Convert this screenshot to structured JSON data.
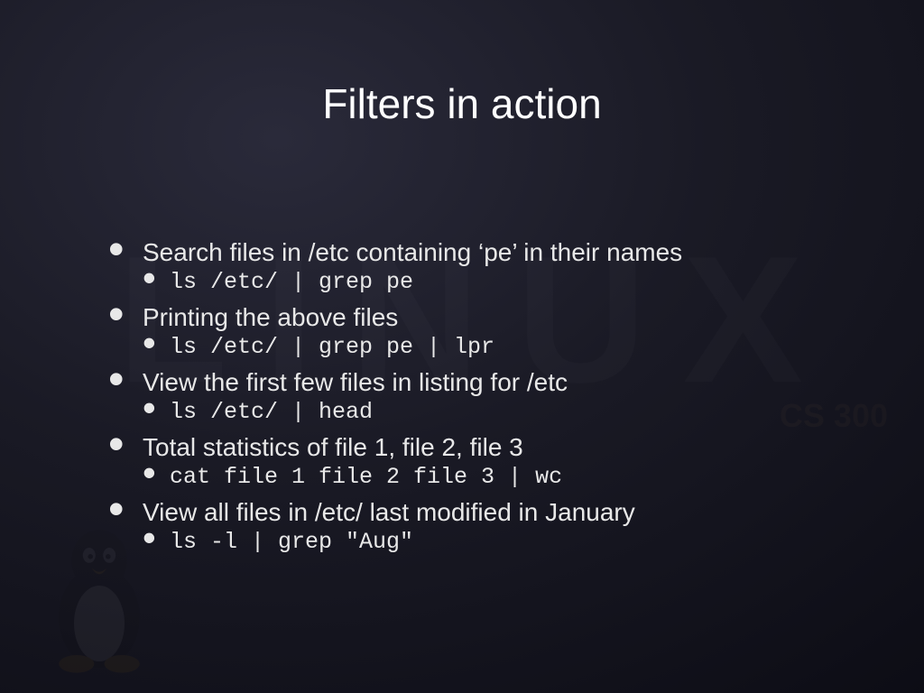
{
  "title": "Filters in action",
  "watermark_big": "LINUX",
  "watermark_small": "CS 300",
  "bullets": [
    {
      "text": "Search files in /etc containing ‘pe’ in their names",
      "code": "ls /etc/ | grep pe"
    },
    {
      "text": "Printing the above files",
      "code": "ls /etc/ | grep pe | lpr"
    },
    {
      "text": "View the first few files in listing for /etc",
      "code": "ls /etc/ | head"
    },
    {
      "text": "Total statistics of file 1, file 2, file 3",
      "code": "cat file 1 file 2 file 3 | wc"
    },
    {
      "text": "View all files in /etc/ last modified in January",
      "code": "ls -l | grep \"Aug\""
    }
  ]
}
